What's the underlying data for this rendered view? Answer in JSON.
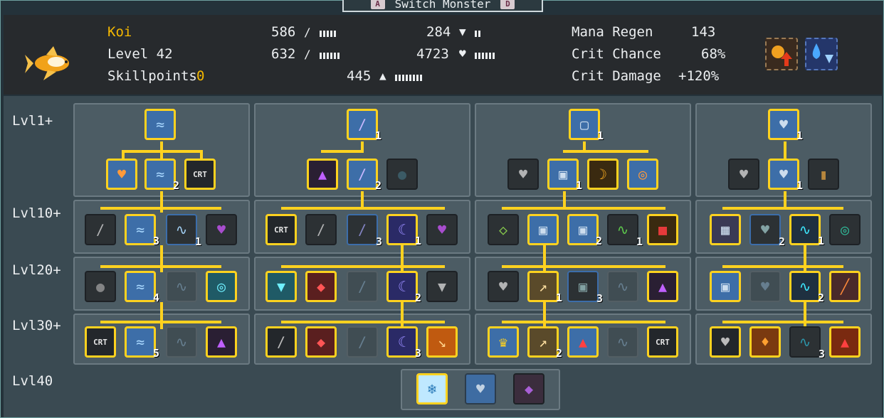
{
  "window": {
    "title": "Switch Monster",
    "key_left": "A",
    "key_right": "D"
  },
  "monster": {
    "name": "Koi",
    "level": "Level 42",
    "skillpoints_label": "Skillpoints",
    "skillpoints_value": "0",
    "icon": "koi-fish-icon"
  },
  "stats": {
    "attack": "586",
    "magic_attack": "632",
    "defense": "284",
    "health": "4723",
    "mana": "445",
    "mana_regen_label": "Mana Regen",
    "mana_regen_value": "143",
    "crit_chance_label": "Crit Chance",
    "crit_chance_value": "68%",
    "crit_damage_label": "Crit Damage",
    "crit_damage_value": "+120%"
  },
  "levels": [
    "Lvl1+",
    "Lvl10+",
    "Lvl20+",
    "Lvl30+",
    "Lvl40"
  ],
  "skill_counts": {
    "t1_root": "",
    "t1_r2b": "2",
    "t1_r3b": "3",
    "t1_r3c": "1",
    "t1_r4b": "4",
    "t1_r5b": "5",
    "t2_root": "1",
    "t2_r2b": "2",
    "t2_r3c": "3",
    "t2_r3d": "1",
    "t2_r4c": "2",
    "t2_r5d": "3",
    "t3_root": "1",
    "t3_r2b": "1",
    "t3_r3c": "2",
    "t3_r3d": "1",
    "t3_r4b": "1",
    "t3_r4c": "3",
    "t3_r5b": "2",
    "t4_root": "1",
    "t4_r2b": "1",
    "t4_r3b": "2",
    "t4_r3c": "1",
    "t4_r4c": "2",
    "t4_r5c": "3"
  },
  "crt_label": "CRT",
  "accent_color": "#ffd21f"
}
